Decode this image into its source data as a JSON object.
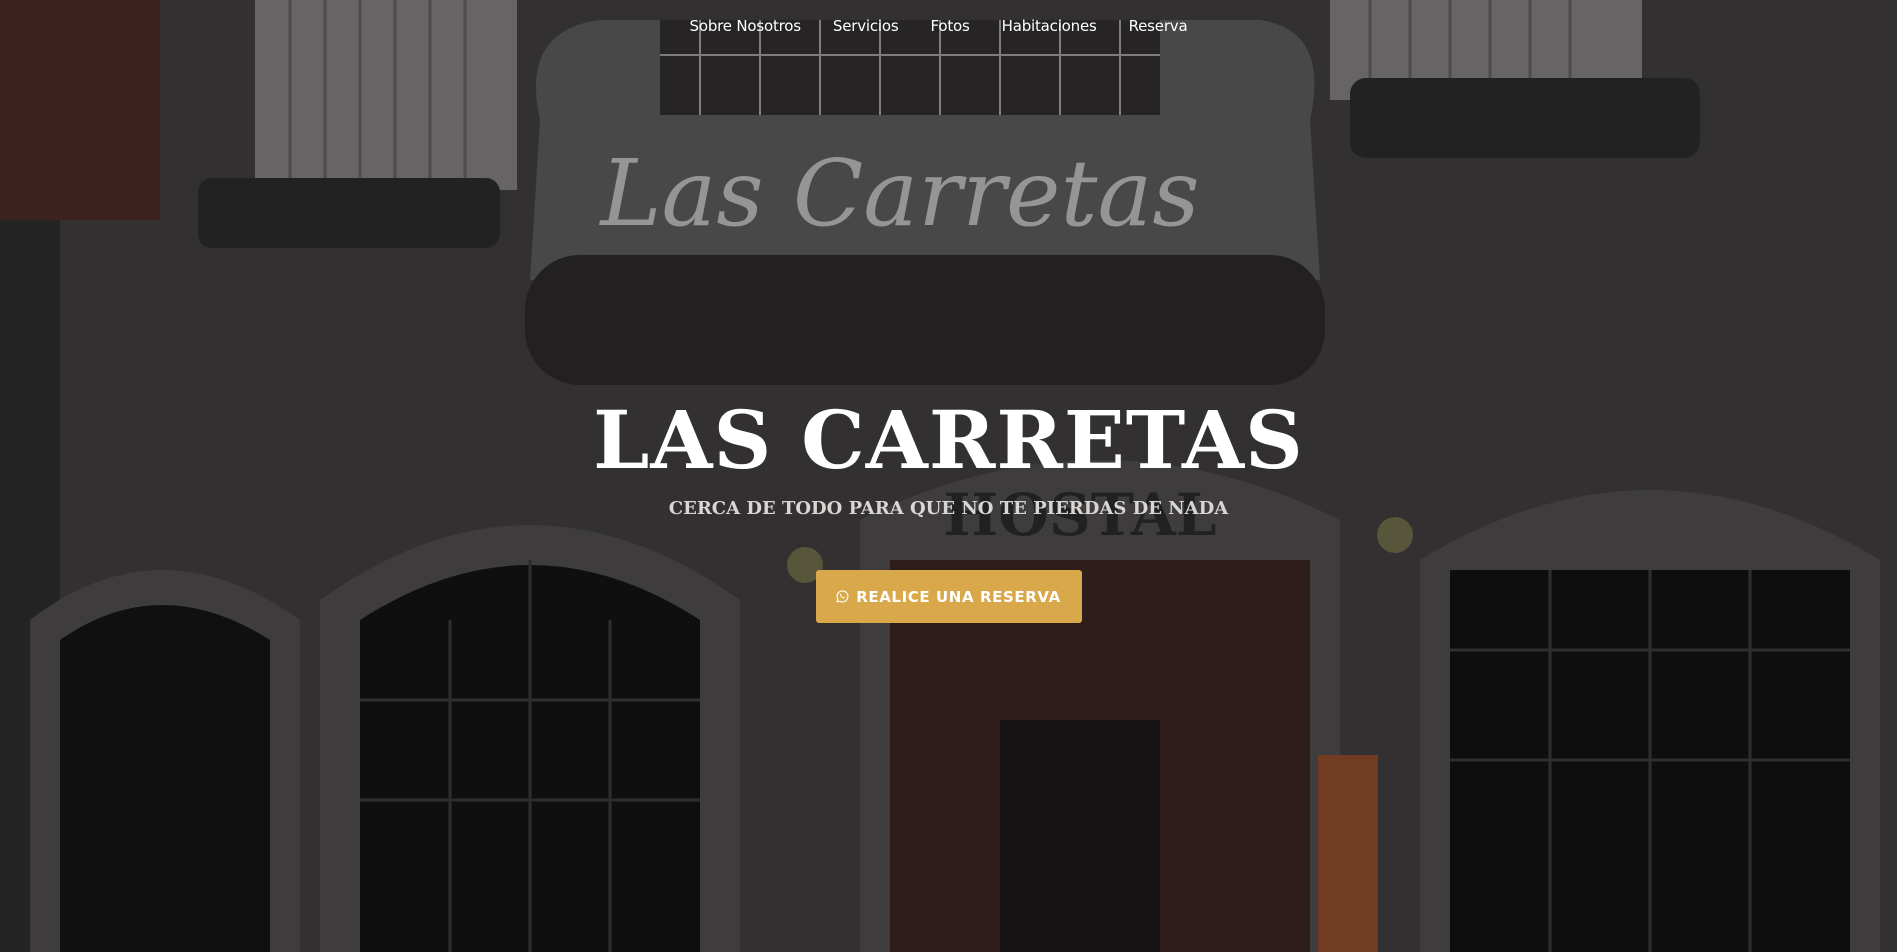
{
  "nav": {
    "items": [
      {
        "label": "Sobre Nosotros"
      },
      {
        "label": "Servicios"
      },
      {
        "label": "Fotos"
      },
      {
        "label": "Habitaciones"
      },
      {
        "label": "Reserva"
      }
    ]
  },
  "hero": {
    "title": "LAS CARRETAS",
    "subtitle": "CERCA DE TODO PARA QUE NO TE PIERDAS DE NADA",
    "cta_label": "REALICE UNA RESERVA",
    "cta_icon": "whatsapp-icon",
    "background": {
      "sign_text": "Las Carretas",
      "facade_sign_text": "HOSTAL"
    }
  },
  "colors": {
    "accent": "#d9a84b",
    "text": "#ffffff",
    "subtitle": "#d8d6d3"
  }
}
